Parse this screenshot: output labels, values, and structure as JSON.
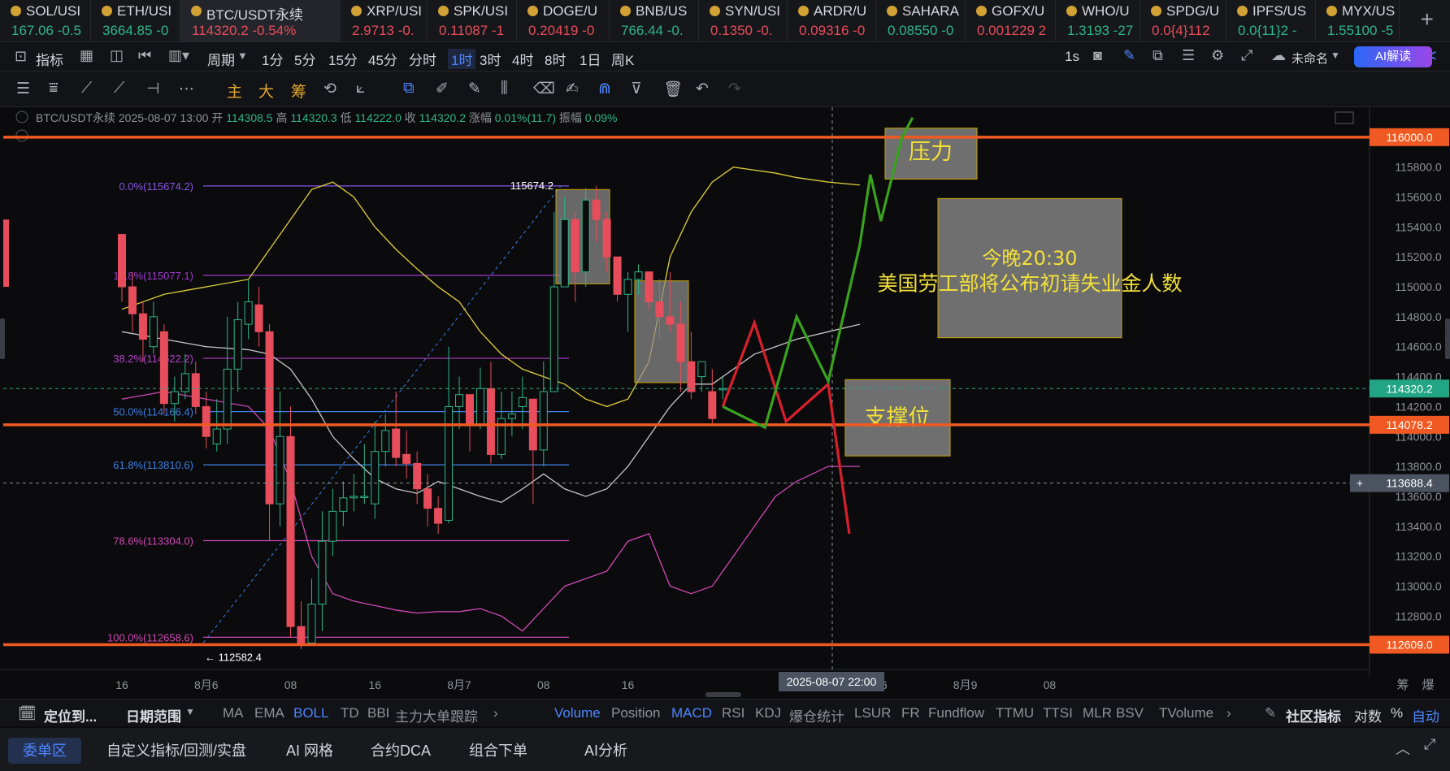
{
  "tickers": [
    {
      "sym": "SOL/USI",
      "price": "167.06 -0.5",
      "dir": "up",
      "active": false
    },
    {
      "sym": "ETH/USI",
      "price": "3664.85 -0",
      "dir": "up",
      "active": false
    },
    {
      "sym": "BTC/USDT永续",
      "price": "114320.2 -0.54%",
      "dir": "dn",
      "active": true
    },
    {
      "sym": "XRP/USI",
      "price": "2.9713 -0.",
      "dir": "dn",
      "active": false
    },
    {
      "sym": "SPK/USI",
      "price": "0.11087 -1",
      "dir": "dn",
      "active": false
    },
    {
      "sym": "DOGE/U",
      "price": "0.20419 -0",
      "dir": "dn",
      "active": false
    },
    {
      "sym": "BNB/US",
      "price": "766.44 -0.",
      "dir": "up",
      "active": false
    },
    {
      "sym": "SYN/USI",
      "price": "0.1350 -0.",
      "dir": "dn",
      "active": false
    },
    {
      "sym": "ARDR/U",
      "price": "0.09316 -0",
      "dir": "dn",
      "active": false
    },
    {
      "sym": "SAHARA",
      "price": "0.08550 -0",
      "dir": "up",
      "active": false
    },
    {
      "sym": "GOFX/U",
      "price": "0.001229 2",
      "dir": "dn",
      "active": false
    },
    {
      "sym": "WHO/U",
      "price": "1.3193 -27",
      "dir": "up",
      "active": false
    },
    {
      "sym": "SPDG/U",
      "price": "0.0{4}112",
      "dir": "dn",
      "active": false
    },
    {
      "sym": "IPFS/US",
      "price": "0.0{11}2 -",
      "dir": "up",
      "active": false
    },
    {
      "sym": "MYX/US",
      "price": "1.55100 -5",
      "dir": "up",
      "active": false
    }
  ],
  "toolbar": {
    "indicator": "指标",
    "period": "周期",
    "intervals": [
      "1分",
      "5分",
      "15分",
      "45分",
      "分时",
      "1时",
      "3时",
      "4时",
      "8时",
      "1日",
      "周K"
    ],
    "selected_interval": "1时",
    "speed": "1s",
    "layout_name": "未命名",
    "ai_read": "AI解读"
  },
  "drawing_tools": {
    "main": "主",
    "big": "大",
    "chip": "筹"
  },
  "chart_data": {
    "type": "candlestick",
    "symbol": "BTC/USDT永续",
    "info_line": {
      "date": "2025-08-07 13:00",
      "open_label": "开",
      "open": "114308.5",
      "high_label": "高",
      "high": "114320.3",
      "low_label": "低",
      "low": "114222.0",
      "close_label": "收",
      "close": "114320.2",
      "change_label": "涨幅",
      "change": "0.01%(11.7)",
      "amp_label": "振幅",
      "amp": "0.09%"
    },
    "ylim": [
      112400,
      116200
    ],
    "y_ticks": [
      116000,
      115800,
      115600,
      115400,
      115200,
      115000,
      114800,
      114600,
      114400,
      114200,
      114000,
      113800,
      113600,
      113400,
      113200,
      113000,
      112800
    ],
    "x_ticks": [
      {
        "i": 0,
        "label": "16"
      },
      {
        "i": 8,
        "label": "8月6"
      },
      {
        "i": 16,
        "label": "08"
      },
      {
        "i": 24,
        "label": "16"
      },
      {
        "i": 32,
        "label": "8月7"
      },
      {
        "i": 40,
        "label": "08"
      },
      {
        "i": 48,
        "label": "16"
      },
      {
        "i": 64,
        "label": "08"
      },
      {
        "i": 72,
        "label": "16"
      },
      {
        "i": 80,
        "label": "8月9"
      },
      {
        "i": 88,
        "label": "08"
      }
    ],
    "candles": [
      [
        115350,
        115000,
        115350,
        114900
      ],
      [
        115000,
        114820,
        115100,
        114700
      ],
      [
        114820,
        114650,
        114900,
        114500
      ],
      [
        114600,
        114800,
        114900,
        114550
      ],
      [
        114700,
        114220,
        114750,
        114150
      ],
      [
        114220,
        114300,
        114400,
        114100
      ],
      [
        114300,
        114420,
        114550,
        114250
      ],
      [
        114420,
        114200,
        114500,
        114150
      ],
      [
        114200,
        114000,
        114300,
        113920
      ],
      [
        113950,
        114050,
        114250,
        113900
      ],
      [
        114050,
        114450,
        114800,
        113950
      ],
      [
        114450,
        114780,
        114900,
        114300
      ],
      [
        114750,
        114900,
        115050,
        114650
      ],
      [
        114880,
        114700,
        115000,
        114600
      ],
      [
        114700,
        113550,
        114750,
        113300
      ],
      [
        113550,
        114000,
        114300,
        113400
      ],
      [
        114000,
        112730,
        114200,
        112660
      ],
      [
        112730,
        112620,
        112900,
        112580
      ],
      [
        112620,
        112880,
        113050,
        112750
      ],
      [
        112880,
        113300,
        113500,
        112700
      ],
      [
        113300,
        113500,
        113650,
        113200
      ],
      [
        113500,
        113590,
        113700,
        113400
      ],
      [
        113590,
        113600,
        113750,
        113500
      ],
      [
        113600,
        113600,
        113950,
        113550
      ],
      [
        113550,
        113900,
        114100,
        113450
      ],
      [
        113900,
        114040,
        114150,
        113800
      ],
      [
        114050,
        113860,
        114300,
        113800
      ],
      [
        113880,
        113820,
        114040,
        113720
      ],
      [
        113820,
        113650,
        113900,
        113550
      ],
      [
        113650,
        113520,
        113750,
        113400
      ],
      [
        113520,
        113420,
        113600,
        113350
      ],
      [
        113440,
        114200,
        114600,
        113420
      ],
      [
        114200,
        114280,
        114400,
        114050
      ],
      [
        114280,
        114080,
        114250,
        113900
      ],
      [
        114080,
        114320,
        114460,
        114050
      ],
      [
        114320,
        113880,
        114500,
        113820
      ],
      [
        113880,
        114120,
        114300,
        113850
      ],
      [
        114120,
        114150,
        114300,
        114000
      ],
      [
        114200,
        114260,
        114400,
        114050
      ],
      [
        114250,
        113910,
        114250,
        113550
      ],
      [
        113910,
        114300,
        114500,
        113800
      ],
      [
        114300,
        115000,
        115500,
        114300
      ],
      [
        115000,
        115450,
        115600,
        115000
      ],
      [
        115450,
        115100,
        115500,
        114900
      ],
      [
        115100,
        115580,
        115660,
        115000
      ],
      [
        115580,
        115450,
        115674,
        115300
      ],
      [
        115450,
        115200,
        115500,
        115100
      ],
      [
        115200,
        114950,
        115150,
        114900
      ],
      [
        114950,
        115050,
        115100,
        114700
      ],
      [
        115050,
        115100,
        115150,
        114950
      ],
      [
        115100,
        114900,
        115100,
        114850
      ],
      [
        114900,
        114800,
        115050,
        114650
      ],
      [
        114800,
        114750,
        115100,
        114700
      ],
      [
        114750,
        114500,
        114900,
        114300
      ],
      [
        114500,
        114300,
        114700,
        114250
      ],
      [
        114400,
        114500,
        114500,
        114300
      ],
      [
        114300,
        114120,
        114450,
        114080
      ],
      [
        114320,
        114320,
        114400,
        114250
      ]
    ],
    "boll_upper": [
      [
        0,
        114850
      ],
      [
        4,
        114950
      ],
      [
        8,
        115000
      ],
      [
        12,
        115050
      ],
      [
        14,
        115250
      ],
      [
        16,
        115450
      ],
      [
        18,
        115650
      ],
      [
        20,
        115700
      ],
      [
        22,
        115600
      ],
      [
        24,
        115400
      ],
      [
        26,
        115250
      ],
      [
        28,
        115120
      ],
      [
        30,
        115000
      ],
      [
        32,
        114900
      ],
      [
        34,
        114700
      ],
      [
        36,
        114550
      ],
      [
        38,
        114450
      ],
      [
        40,
        114400
      ],
      [
        42,
        114350
      ],
      [
        44,
        114250
      ],
      [
        46,
        114200
      ],
      [
        48,
        114250
      ],
      [
        50,
        114500
      ],
      [
        52,
        115200
      ],
      [
        54,
        115500
      ],
      [
        56,
        115700
      ],
      [
        58,
        115800
      ],
      [
        60,
        115780
      ],
      [
        62,
        115760
      ],
      [
        64,
        115730
      ],
      [
        67,
        115700
      ],
      [
        70,
        115680
      ]
    ],
    "boll_mid": [
      [
        0,
        114700
      ],
      [
        4,
        114650
      ],
      [
        8,
        114600
      ],
      [
        12,
        114580
      ],
      [
        14,
        114550
      ],
      [
        16,
        114450
      ],
      [
        18,
        114250
      ],
      [
        20,
        114000
      ],
      [
        22,
        113850
      ],
      [
        24,
        113720
      ],
      [
        26,
        113650
      ],
      [
        28,
        113620
      ],
      [
        30,
        113700
      ],
      [
        32,
        113650
      ],
      [
        34,
        113600
      ],
      [
        36,
        113560
      ],
      [
        38,
        113650
      ],
      [
        40,
        113750
      ],
      [
        42,
        113650
      ],
      [
        44,
        113600
      ],
      [
        46,
        113650
      ],
      [
        48,
        113800
      ],
      [
        50,
        114000
      ],
      [
        52,
        114200
      ],
      [
        54,
        114350
      ],
      [
        56,
        114350
      ],
      [
        58,
        114450
      ],
      [
        60,
        114550
      ],
      [
        62,
        114600
      ],
      [
        64,
        114650
      ],
      [
        67,
        114700
      ],
      [
        70,
        114750
      ]
    ],
    "boll_lower": [
      [
        0,
        114250
      ],
      [
        4,
        114300
      ],
      [
        8,
        114250
      ],
      [
        12,
        114200
      ],
      [
        14,
        114050
      ],
      [
        16,
        113700
      ],
      [
        18,
        113200
      ],
      [
        20,
        112950
      ],
      [
        22,
        112900
      ],
      [
        24,
        112870
      ],
      [
        26,
        112840
      ],
      [
        28,
        112820
      ],
      [
        30,
        112830
      ],
      [
        32,
        112830
      ],
      [
        34,
        112850
      ],
      [
        36,
        112800
      ],
      [
        38,
        112700
      ],
      [
        40,
        112850
      ],
      [
        42,
        113000
      ],
      [
        44,
        113050
      ],
      [
        46,
        113100
      ],
      [
        48,
        113300
      ],
      [
        50,
        113350
      ],
      [
        52,
        113000
      ],
      [
        54,
        112950
      ],
      [
        56,
        113000
      ],
      [
        58,
        113200
      ],
      [
        60,
        113400
      ],
      [
        62,
        113600
      ],
      [
        64,
        113700
      ],
      [
        67,
        113800
      ],
      [
        70,
        113800
      ]
    ],
    "fib_levels": [
      {
        "label": "0.0%(115674.2)",
        "value": 115674.2,
        "color": "#8a55e6"
      },
      {
        "label": "19.8%(115077.1)",
        "value": 115077.1,
        "color": "#a03ad0"
      },
      {
        "label": "38.2%(114522.2)",
        "value": 114522.2,
        "color": "#b23ec7"
      },
      {
        "label": "50.0%(114166.4)",
        "value": 114166.4,
        "color": "#3f7fe0"
      },
      {
        "label": "61.8%(113810.6)",
        "value": 113810.6,
        "color": "#3f7fe0"
      },
      {
        "label": "78.6%(113304.0)",
        "value": 113304.0,
        "color": "#d048b5"
      },
      {
        "label": "100.0%(112658.6)",
        "value": 112658.6,
        "color": "#d048b5"
      }
    ],
    "high_mark": "115674.2",
    "low_mark": "← 112582.4",
    "hlines": [
      {
        "value": 116000,
        "label": "116000.0"
      },
      {
        "value": 114078.2,
        "label": "114078.2"
      },
      {
        "value": 112609,
        "label": "112609.0"
      }
    ],
    "current_price": {
      "value": 114320.2,
      "label": "114320.2"
    },
    "crosshair": {
      "value": 113688.4,
      "label": "113688.4",
      "time": "2025-08-07 22:00",
      "time_index": 61
    },
    "projection_green": [
      [
        57,
        114200
      ],
      [
        61,
        114060
      ],
      [
        64,
        114800
      ],
      [
        67,
        114370
      ],
      [
        70,
        115280
      ],
      [
        71,
        115750
      ],
      [
        72,
        115440
      ],
      [
        74,
        116000
      ],
      [
        75,
        116130
      ]
    ],
    "projection_red": [
      [
        57,
        114200
      ],
      [
        60,
        114760
      ],
      [
        63,
        114100
      ],
      [
        67,
        114350
      ],
      [
        69,
        113350
      ]
    ],
    "annotations": [
      {
        "text": "压力"
      },
      {
        "text": "今晚20:30",
        "text2": "美国劳工部将公布初请失业金人数"
      },
      {
        "text": "支撑位"
      }
    ],
    "y_footer": [
      "筹",
      "爆"
    ]
  },
  "bottom": {
    "locate": "定位到...",
    "range": "日期范围",
    "main_inds": [
      "MA",
      "EMA",
      "BOLL",
      "TD",
      "BBI",
      "主力大单跟踪"
    ],
    "sub_inds": [
      "Volume",
      "Position",
      "MACD",
      "RSI",
      "KDJ",
      "爆仓统计",
      "LSUR",
      "FR",
      "Fundflow",
      "TTMU",
      "TTSI",
      "MLR",
      "BSV",
      "TVolume"
    ],
    "community": "社区指标",
    "log": "对数",
    "pct": "%",
    "auto": "自动"
  },
  "tabs": [
    "委单区",
    "自定义指标/回测/实盘",
    "AI 网格",
    "合约DCA",
    "组合下单",
    "AI分析"
  ]
}
